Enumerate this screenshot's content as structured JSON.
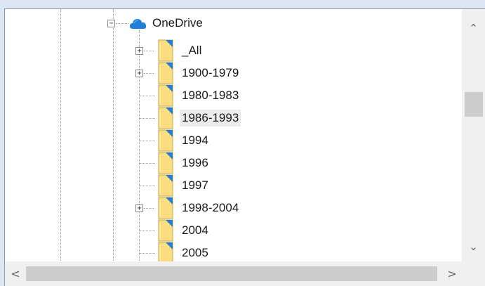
{
  "tree": {
    "root": {
      "label": "OneDrive",
      "icon": "onedrive-cloud-icon",
      "expanded": true
    },
    "children": [
      {
        "label": "_All",
        "expandable": true,
        "selected": false
      },
      {
        "label": "1900-1979",
        "expandable": true,
        "selected": false
      },
      {
        "label": "1980-1983",
        "expandable": false,
        "selected": false
      },
      {
        "label": "1986-1993",
        "expandable": false,
        "selected": true
      },
      {
        "label": "1994",
        "expandable": false,
        "selected": false
      },
      {
        "label": "1996",
        "expandable": false,
        "selected": false
      },
      {
        "label": "1997",
        "expandable": false,
        "selected": false
      },
      {
        "label": "1998-2004",
        "expandable": true,
        "selected": false
      },
      {
        "label": "2004",
        "expandable": false,
        "selected": false
      },
      {
        "label": "2005",
        "expandable": false,
        "selected": false
      }
    ]
  },
  "expander": {
    "collapse_glyph": "−",
    "expand_glyph": "+"
  },
  "scrollbars": {
    "vertical": {
      "up_glyph": "⌃",
      "down_glyph": "⌄"
    },
    "horizontal": {
      "left_glyph": "<",
      "right_glyph": ">"
    }
  },
  "colors": {
    "folder_fill": "#f9dd7e",
    "folder_tab": "#2a7bd0",
    "cloud": "#1f7fd6",
    "selection": "#ececec"
  }
}
